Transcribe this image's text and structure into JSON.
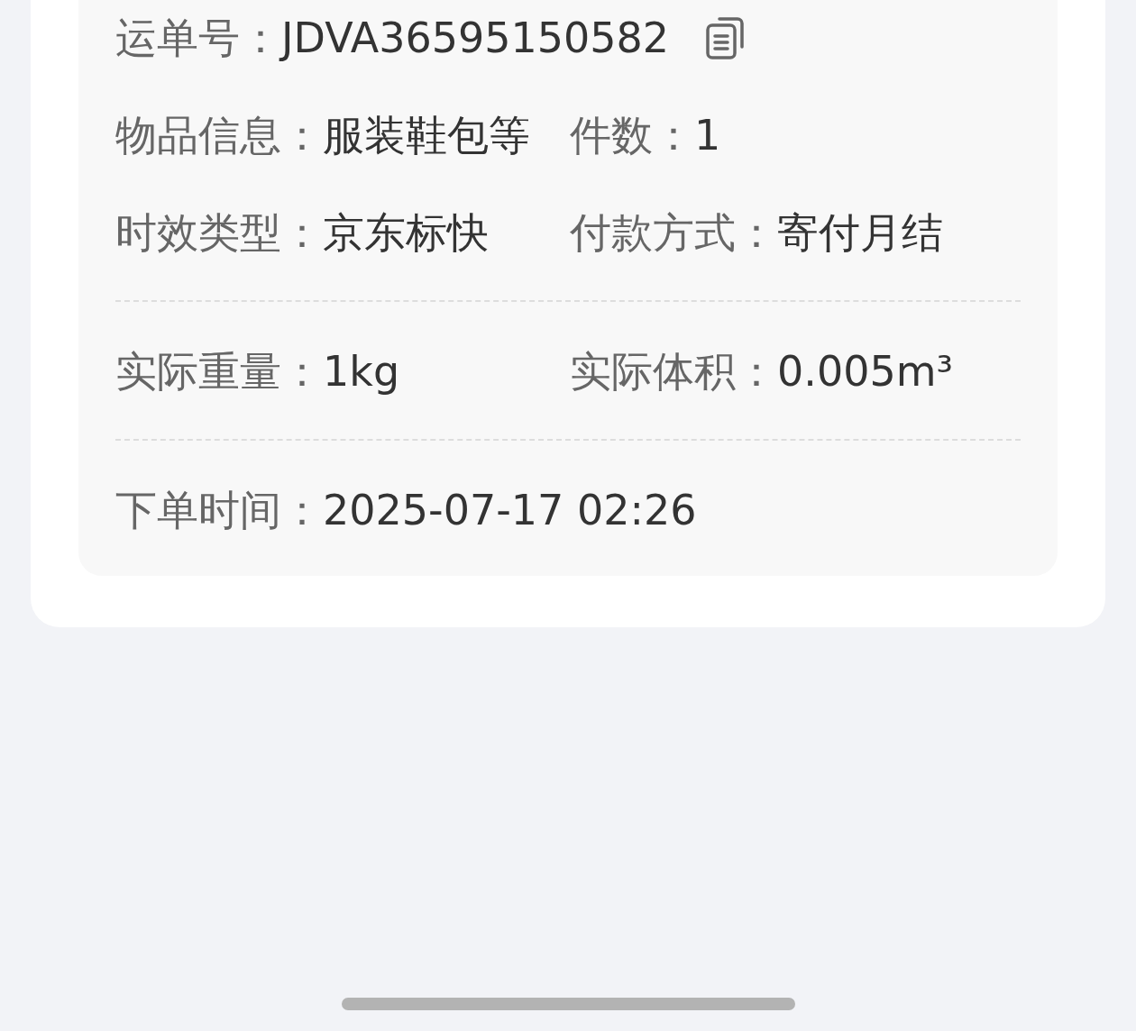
{
  "sections": [
    {
      "rows": [
        {
          "fields": [
            {
              "kind": "copyable",
              "label": "运单号：",
              "value": "JDVA36595150582"
            }
          ]
        },
        {
          "fields": [
            {
              "kind": "plain",
              "label": "物品信息：",
              "value": "服装鞋包等"
            },
            {
              "kind": "plain",
              "label": "件数：",
              "value": "1"
            }
          ]
        },
        {
          "fields": [
            {
              "kind": "plain",
              "label": "时效类型：",
              "value": "京东标快"
            },
            {
              "kind": "plain",
              "label": "付款方式：",
              "value": "寄付月结"
            }
          ]
        }
      ]
    },
    {
      "rows": [
        {
          "fields": [
            {
              "kind": "plain",
              "label": "实际重量：",
              "value": "1kg"
            },
            {
              "kind": "plain",
              "label": "实际体积：",
              "value": "0.005m³"
            }
          ]
        }
      ]
    },
    {
      "rows": [
        {
          "fields": [
            {
              "kind": "plain",
              "label": "下单时间：",
              "value": "2025-07-17 02:26"
            }
          ]
        }
      ]
    }
  ]
}
